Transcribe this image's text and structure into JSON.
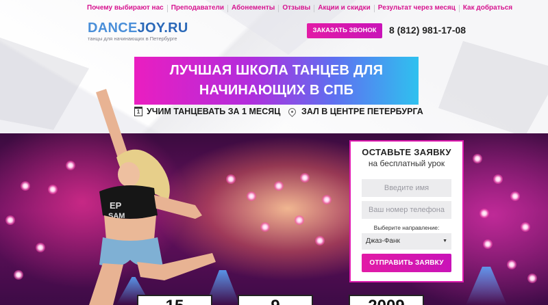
{
  "nav": {
    "items": [
      "Почему выбирают нас",
      "Преподаватели",
      "Абонементы",
      "Отзывы",
      "Акции и скидки",
      "Результат через месяц",
      "Как добраться"
    ]
  },
  "header": {
    "logo_part1": "DANCE",
    "logo_part2": "JOY.RU",
    "logo_tagline": "танцы для начинающих в Петербурге",
    "call_button": "ЗАКАЗАТЬ ЗВОНОК",
    "phone": "8 (812) 981-17-08"
  },
  "hero": {
    "headline_line1": "ЛУЧШАЯ ШКОЛА ТАНЦЕВ ДЛЯ",
    "headline_line2": "НАЧИНАЮЩИХ В СПБ",
    "feature1": "УЧИМ ТАНЦЕВАТЬ ЗА 1 МЕСЯЦ",
    "feature1_icon_digit": "1",
    "feature2": "ЗАЛ В ЦЕНТРЕ ПЕТЕРБУРГА",
    "icons": [
      "calendar-icon",
      "location-pin-icon"
    ]
  },
  "form": {
    "title": "ОСТАВЬТЕ ЗАЯВКУ",
    "subtitle": "на бесплатный урок",
    "name_placeholder": "Введите имя",
    "phone_placeholder": "Ваш номер телефона",
    "direction_label": "Выберите направление:",
    "direction_selected": "Джаз-Фанк",
    "submit": "ОТПРАВИТЬ ЗАЯВКУ"
  },
  "stats": [
    "15",
    "9",
    "2009"
  ],
  "colors": {
    "accent_pink": "#e21ba6",
    "logo_blue": "#4a8fd9",
    "headline_gradient_start": "#ea1ec0",
    "headline_gradient_end": "#2fc1ef"
  }
}
